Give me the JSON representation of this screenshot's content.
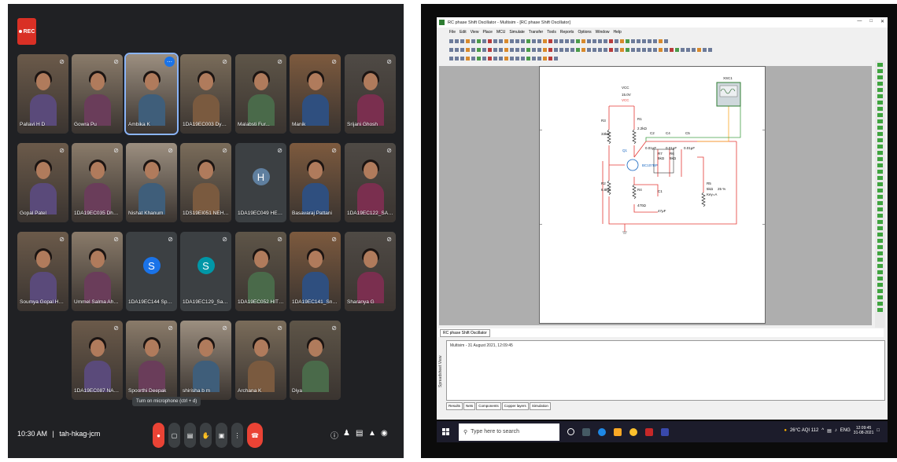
{
  "meeting": {
    "rec_label": "REC",
    "time": "10:30 AM",
    "meeting_code": "tah-hkag-jcm",
    "tooltip": "Turn on microphone (ctrl + d)",
    "participants": [
      {
        "name": "Pallavi H D"
      },
      {
        "name": "Gowra Pu"
      },
      {
        "name": "Ambika K",
        "active": true
      },
      {
        "name": "1DA19EC003 Dyeeya..."
      },
      {
        "name": "Malabsti Fur..."
      },
      {
        "name": "Manik"
      },
      {
        "name": "Srijani Ghosh"
      },
      {
        "name": "Gopal Patel"
      },
      {
        "name": "1DA19EC035 Dhnya..."
      },
      {
        "name": "Nishat Khanum"
      },
      {
        "name": "1DS19EI051 NEHA G"
      },
      {
        "name": "1DA19EC049 HEMA R S",
        "initial": "H",
        "avatar_color": "#5f7f9f"
      },
      {
        "name": "Basavaraj Pattani"
      },
      {
        "name": "1DA19EC122_SAHAN..."
      },
      {
        "name": "Soumya Gopal Hegde"
      },
      {
        "name": "Ummel Salma Ahmed"
      },
      {
        "name": "1DA19EC144 Spoorthy...",
        "initial": "S",
        "avatar_color": "#1a73e8"
      },
      {
        "name": "1DA19EC129_Sahana...",
        "initial": "S",
        "avatar_color": "#0097a7"
      },
      {
        "name": "1DA19EC052 HITHA..."
      },
      {
        "name": "1DA19EC141_Sneha G..."
      },
      {
        "name": "Sharanya G"
      },
      {
        "name": "1DA19EC087 NAND..."
      },
      {
        "name": "Spoorthi Deepak"
      },
      {
        "name": "shirisha b m"
      },
      {
        "name": "Archana K"
      },
      {
        "name": "Diya"
      }
    ]
  },
  "multisim": {
    "window_title": "RC phase Shift Oscillator - Multisim - [RC phase Shift Oscillator]",
    "menu": [
      "File",
      "Edit",
      "View",
      "Place",
      "MCU",
      "Simulate",
      "Transfer",
      "Tools",
      "Reports",
      "Options",
      "Window",
      "Help"
    ],
    "document_tab": "RC phase Shift Oscillator",
    "output_line": "Multisim  -  31 August 2021, 12:09:45",
    "output_panel_label": "Spreadsheet View",
    "output_tabs": [
      "Results",
      "Nets",
      "Components",
      "Copper layers",
      "Simulation"
    ],
    "components": {
      "vcc": "VCC",
      "vcc_val": "15.0V",
      "vcc2": "VCC",
      "r3": "R3",
      "r3v": "33kΩ",
      "r1": "R1",
      "r1v": "2.2kΩ",
      "r2": "R2",
      "r2v": "6.8kΩ",
      "r4": "R4",
      "r4v": "470Ω",
      "q1": "Q1",
      "q1v": "BC107BP",
      "c1": "C1",
      "c1v": "47μF",
      "c2": "C2",
      "c2v": "0.01μF",
      "c4": "C4",
      "c4v": "0.01μF",
      "c5": "C5",
      "c5v": "0.01μF",
      "r7": "R7",
      "r7v": "5kΩ",
      "r6": "R6",
      "r6v": "5kΩ",
      "r5": "R5",
      "r5v": "5kΩ",
      "r5p": "25 %",
      "r5k": "Key=A",
      "xsc1": "XSC1"
    }
  },
  "taskbar": {
    "search_placeholder": "Type here to search",
    "weather": "26°C AQI 112",
    "lang": "ENG",
    "time": "12:09:45",
    "date": "31-08-2021"
  }
}
